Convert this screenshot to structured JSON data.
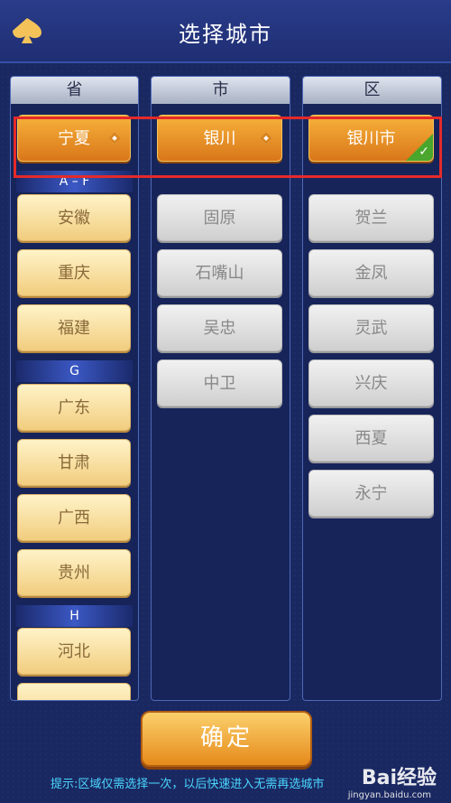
{
  "header": {
    "title": "选择城市"
  },
  "columns": {
    "province": {
      "header": "省",
      "selected": "宁夏",
      "sep_af": "A – F",
      "items_af": [
        "安徽",
        "重庆",
        "福建"
      ],
      "sep_g": "G",
      "items_g": [
        "广东",
        "甘肃",
        "广西",
        "贵州"
      ],
      "sep_h": "H",
      "items_h": [
        "河北"
      ]
    },
    "city": {
      "header": "市",
      "selected": "银川",
      "items": [
        "固原",
        "石嘴山",
        "吴忠",
        "中卫"
      ]
    },
    "district": {
      "header": "区",
      "selected": "银川市",
      "items": [
        "贺兰",
        "金凤",
        "灵武",
        "兴庆",
        "西夏",
        "永宁"
      ]
    }
  },
  "confirm_label": "确定",
  "tip": "提示:区域仅需选择一次，以后快速进入无需再选城市",
  "watermark": {
    "brand": "Bai经验",
    "url": "jingyan.baidu.com"
  },
  "colors": {
    "selected": "#e98a22",
    "highlight": "#e52a2a",
    "tip": "#4ad7ff"
  },
  "icons": {
    "back": "spade-icon",
    "selected_marker": "diamond-icon",
    "check": "check-icon"
  }
}
